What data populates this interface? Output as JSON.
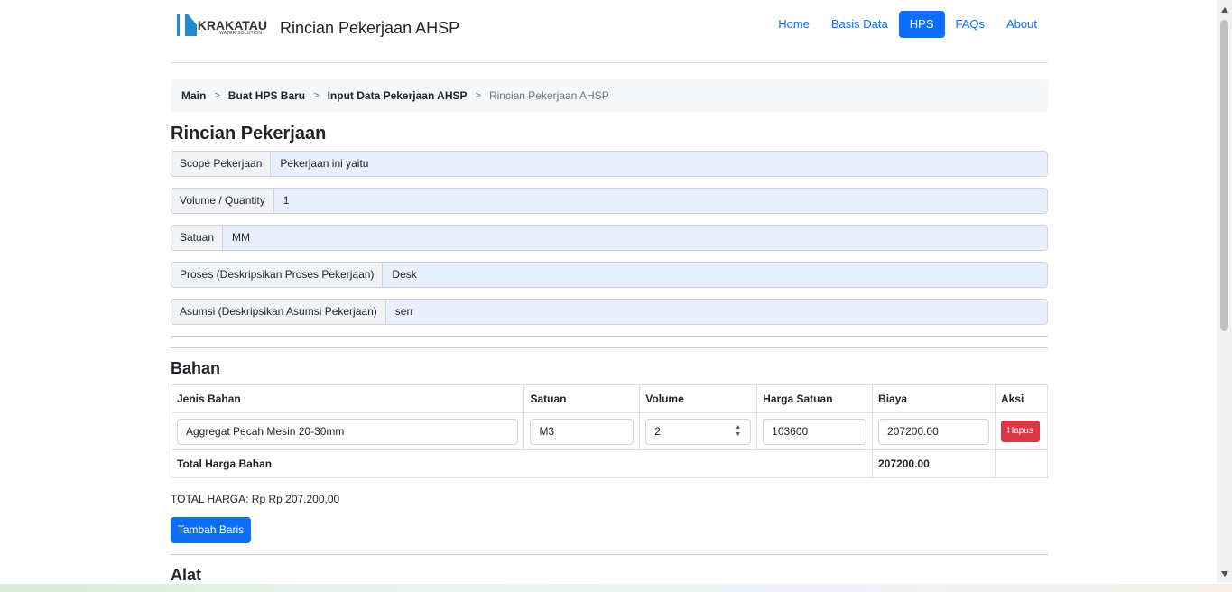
{
  "brand": {
    "logo_text": "KRAKATAU",
    "logo_sub": "WATER SOLUTION",
    "app_title": "Rincian Pekerjaan AHSP"
  },
  "nav": {
    "home": "Home",
    "basis_data": "Basis Data",
    "hps": "HPS",
    "faqs": "FAQs",
    "about": "About"
  },
  "breadcrumb": {
    "main": "Main",
    "buat": "Buat HPS Baru",
    "input": "Input Data Pekerjaan AHSP",
    "current": "Rincian Pekerjaan AHSP"
  },
  "rincian": {
    "heading": "Rincian Pekerjaan",
    "fields": [
      {
        "label": "Scope Pekerjaan",
        "value": "Pekerjaan ini yaitu"
      },
      {
        "label": "Volume / Quantity",
        "value": "1"
      },
      {
        "label": "Satuan",
        "value": "MM"
      },
      {
        "label": "Proses (Deskripsikan Proses Pekerjaan)",
        "value": "Desk"
      },
      {
        "label": "Asumsi (Deskripsikan Asumsi Pekerjaan)",
        "value": "serr"
      }
    ]
  },
  "bahan": {
    "heading": "Bahan",
    "columns": [
      "Jenis Bahan",
      "Satuan",
      "Volume",
      "Harga Satuan",
      "Biaya",
      "Aksi"
    ],
    "row": {
      "jenis": "Aggregat Pecah Mesin 20-30mm",
      "satuan": "M3",
      "volume": "2",
      "harga": "103600",
      "biaya": "207200.00",
      "aksi": "Hapus"
    },
    "total_label": "Total Harga Bahan",
    "total_value": "207200.00",
    "total_harga": "TOTAL HARGA: Rp Rp 207.200,00",
    "add_button": "Tambah Baris"
  },
  "alat": {
    "heading": "Alat"
  },
  "colors": {
    "primary": "#0d6efd",
    "danger": "#dc3545",
    "input_bg": "#e8f0fe"
  }
}
